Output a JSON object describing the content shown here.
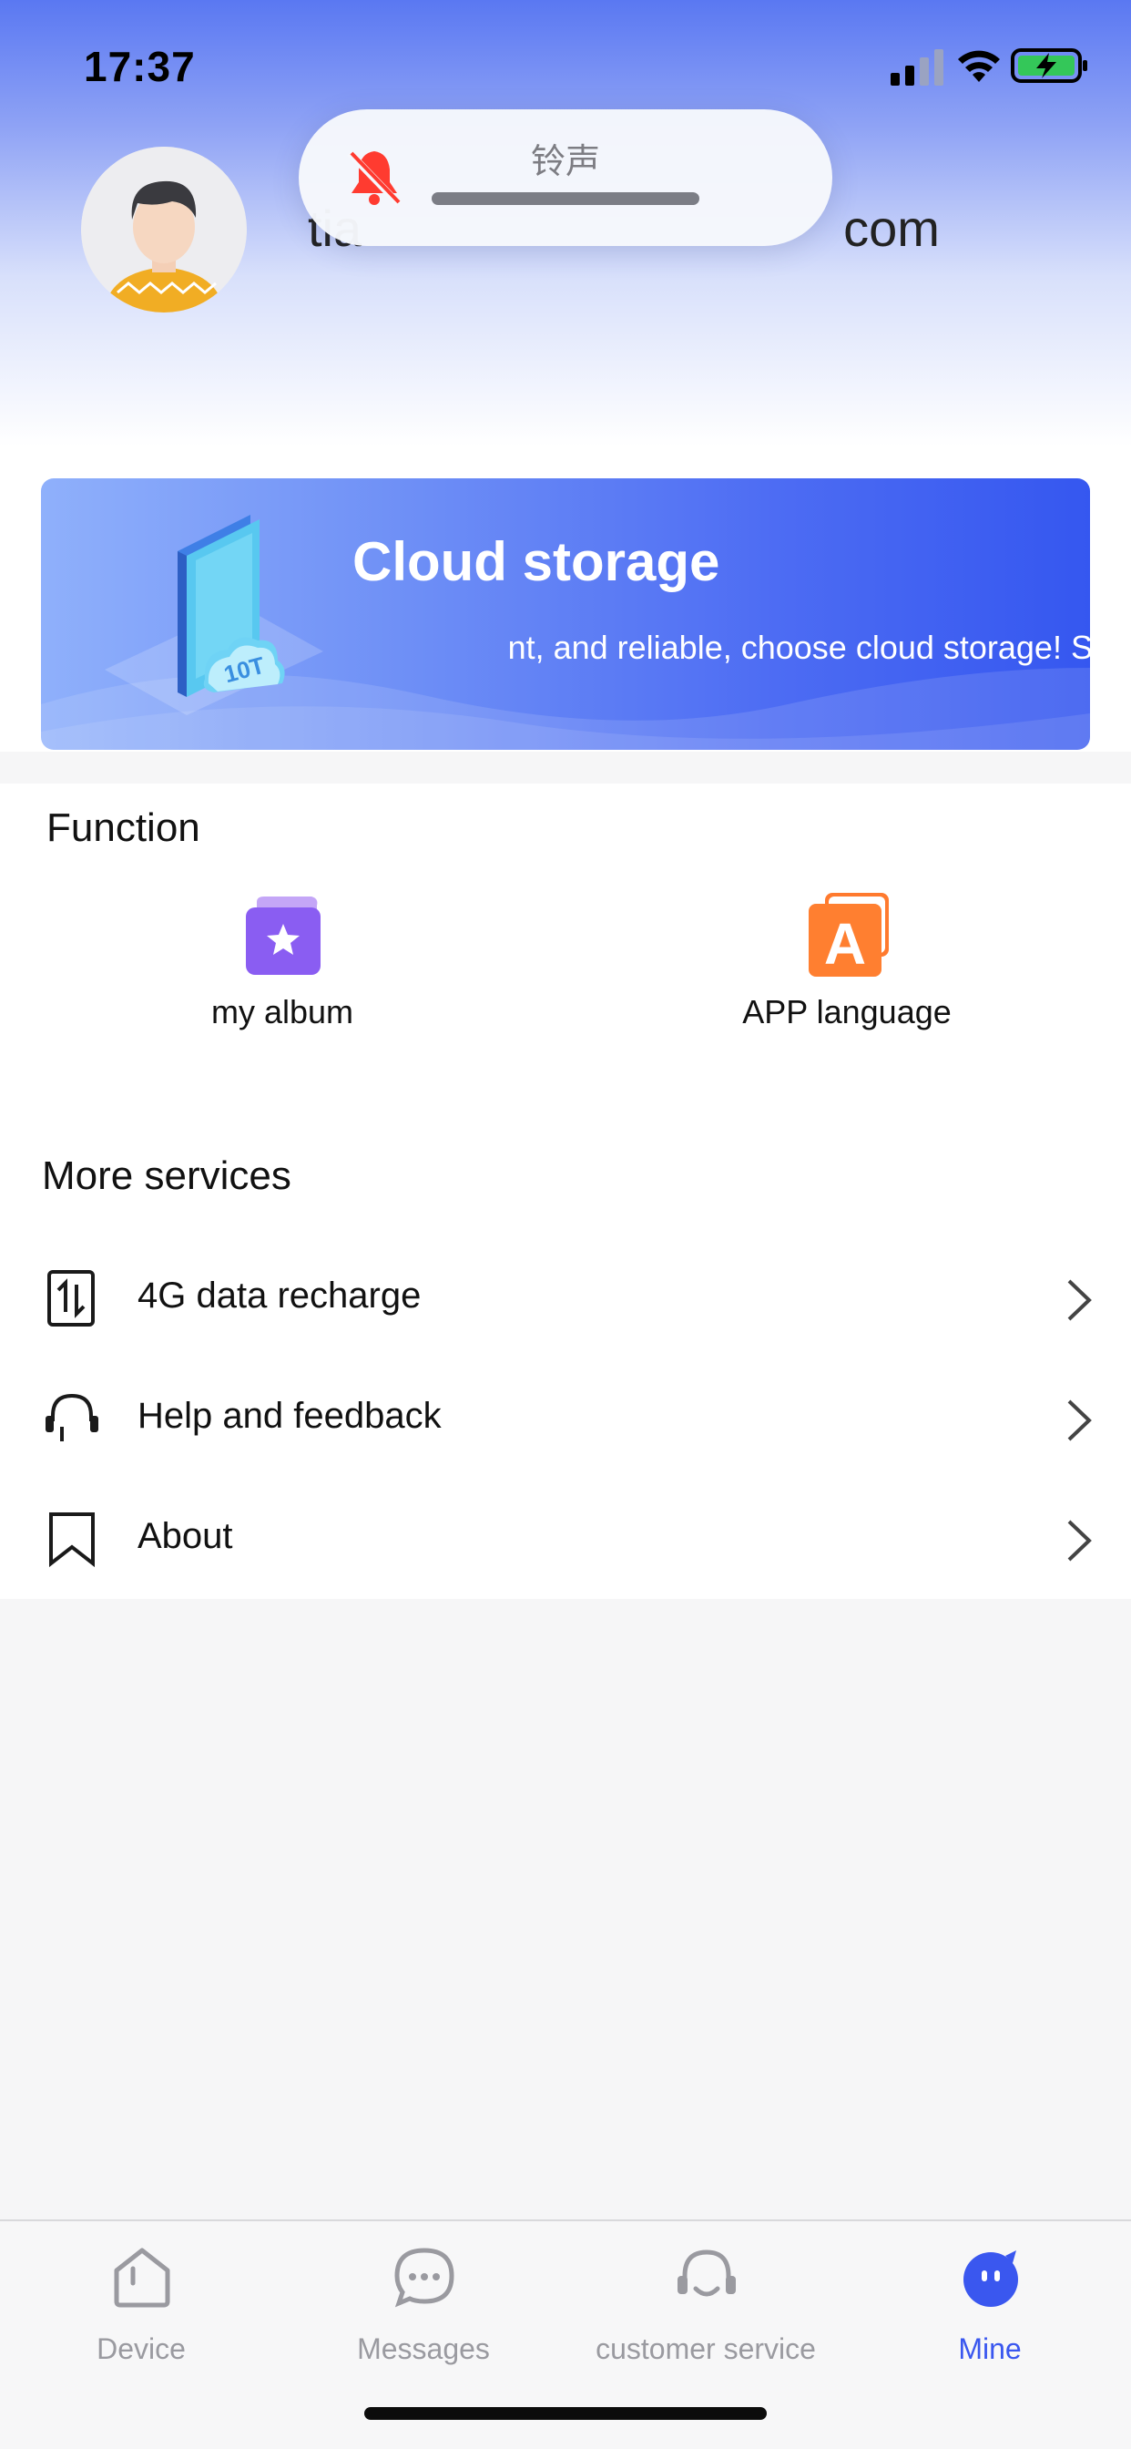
{
  "status_bar": {
    "time": "17:37",
    "icons": [
      "cellular-signal-icon",
      "wifi-icon",
      "battery-charging-icon"
    ]
  },
  "profile": {
    "avatar": "avatar",
    "username": "tia                                  com"
  },
  "toast": {
    "label": "铃声",
    "icon": "bell-muted-icon",
    "accent": "#ff3b30"
  },
  "banner": {
    "title": "Cloud storage",
    "marquee_text": "nt, and reliable, choose cloud storage!     Sa",
    "badge": "10T"
  },
  "function": {
    "title": "Function",
    "items": [
      {
        "label": "my album",
        "icon": "album-star-icon"
      },
      {
        "label": "APP language",
        "icon": "language-a-icon"
      }
    ]
  },
  "more_services": {
    "title": "More services",
    "items": [
      {
        "label": "4G data recharge",
        "icon": "sim-recharge-icon"
      },
      {
        "label": "Help and feedback",
        "icon": "headset-icon"
      },
      {
        "label": "About",
        "icon": "bookmark-icon"
      }
    ]
  },
  "tabbar": {
    "tabs": [
      {
        "label": "Device",
        "icon": "home-icon",
        "active": false
      },
      {
        "label": "Messages",
        "icon": "chat-bubble-icon",
        "active": false
      },
      {
        "label": "customer service",
        "icon": "headset-icon",
        "active": false
      },
      {
        "label": "Mine",
        "icon": "mine-face-icon",
        "active": true
      }
    ],
    "active_color": "#3a57ef",
    "inactive_color": "#9a9aa0"
  }
}
